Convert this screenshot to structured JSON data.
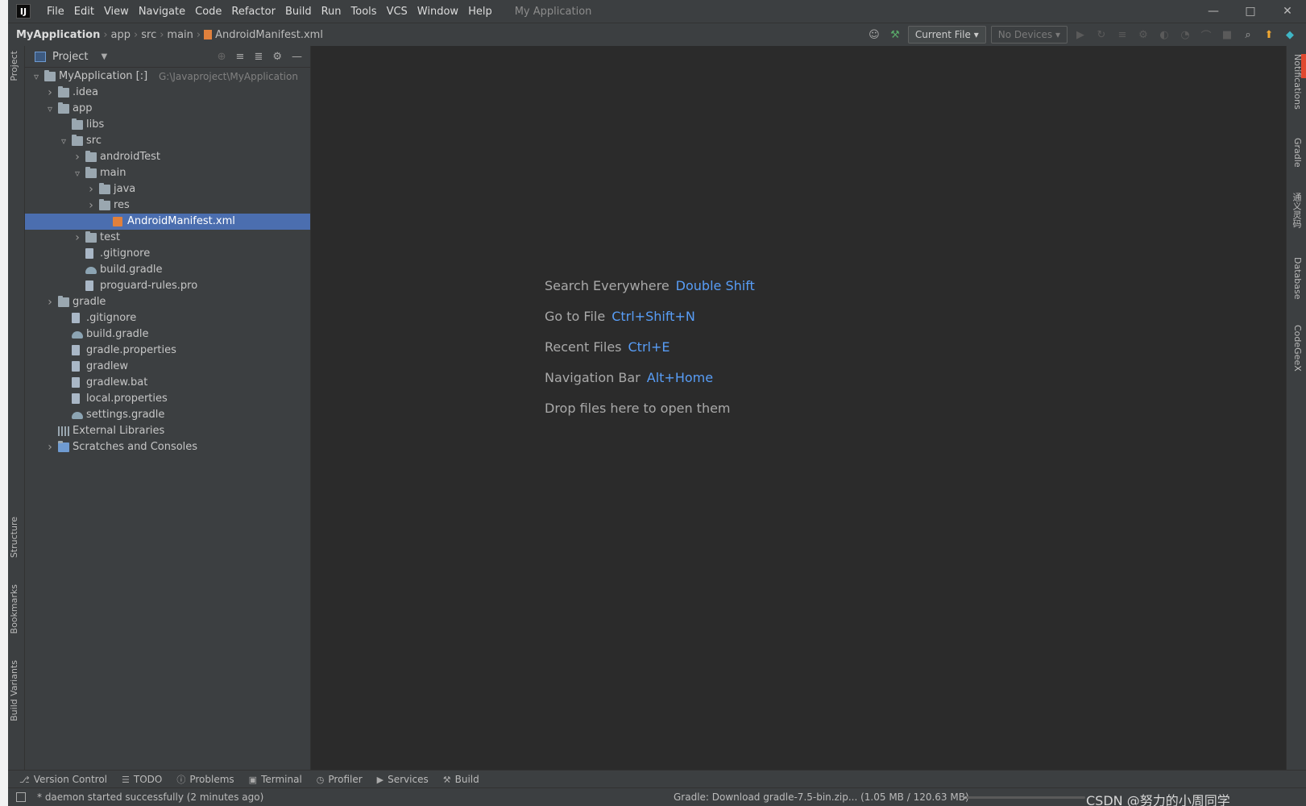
{
  "titlebar": {
    "menu": [
      "File",
      "Edit",
      "View",
      "Navigate",
      "Code",
      "Refactor",
      "Build",
      "Run",
      "Tools",
      "VCS",
      "Window",
      "Help"
    ],
    "app_title": "My Application"
  },
  "breadcrumb": [
    "MyApplication",
    "app",
    "src",
    "main",
    "AndroidManifest.xml"
  ],
  "toolbar": {
    "run_config": "Current File",
    "device": "No Devices"
  },
  "left_tabs": {
    "project": "Project",
    "structure": "Structure",
    "bookmarks": "Bookmarks",
    "build_variants": "Build Variants"
  },
  "right_tabs": {
    "notifications": "Notifications",
    "gradle": "Gradle",
    "translate": "通义灵码",
    "database": "Database",
    "codegeex": "CodeGeeX"
  },
  "project_panel": {
    "title": "Project",
    "tree": [
      {
        "label": "MyApplication [:]",
        "path": "G:\\Javaproject\\MyApplication",
        "depth": 0,
        "arrow": "open",
        "icon": "module"
      },
      {
        "label": ".idea",
        "depth": 1,
        "arrow": "closed",
        "icon": "folder"
      },
      {
        "label": "app",
        "depth": 1,
        "arrow": "open",
        "icon": "folder"
      },
      {
        "label": "libs",
        "depth": 2,
        "arrow": "none",
        "icon": "folder"
      },
      {
        "label": "src",
        "depth": 2,
        "arrow": "open",
        "icon": "folder"
      },
      {
        "label": "androidTest",
        "depth": 3,
        "arrow": "closed",
        "icon": "folder"
      },
      {
        "label": "main",
        "depth": 3,
        "arrow": "open",
        "icon": "folder"
      },
      {
        "label": "java",
        "depth": 4,
        "arrow": "closed",
        "icon": "folder"
      },
      {
        "label": "res",
        "depth": 4,
        "arrow": "closed",
        "icon": "folder"
      },
      {
        "label": "AndroidManifest.xml",
        "depth": 5,
        "arrow": "none",
        "icon": "xml",
        "selected": true
      },
      {
        "label": "test",
        "depth": 3,
        "arrow": "closed",
        "icon": "folder"
      },
      {
        "label": ".gitignore",
        "depth": 3,
        "arrow": "none",
        "icon": "file"
      },
      {
        "label": "build.gradle",
        "depth": 3,
        "arrow": "none",
        "icon": "gradle"
      },
      {
        "label": "proguard-rules.pro",
        "depth": 3,
        "arrow": "none",
        "icon": "file"
      },
      {
        "label": "gradle",
        "depth": 1,
        "arrow": "closed",
        "icon": "folder"
      },
      {
        "label": ".gitignore",
        "depth": 2,
        "arrow": "none",
        "icon": "file"
      },
      {
        "label": "build.gradle",
        "depth": 2,
        "arrow": "none",
        "icon": "gradle"
      },
      {
        "label": "gradle.properties",
        "depth": 2,
        "arrow": "none",
        "icon": "file"
      },
      {
        "label": "gradlew",
        "depth": 2,
        "arrow": "none",
        "icon": "file"
      },
      {
        "label": "gradlew.bat",
        "depth": 2,
        "arrow": "none",
        "icon": "file"
      },
      {
        "label": "local.properties",
        "depth": 2,
        "arrow": "none",
        "icon": "file"
      },
      {
        "label": "settings.gradle",
        "depth": 2,
        "arrow": "none",
        "icon": "gradle"
      },
      {
        "label": "External Libraries",
        "depth": 1,
        "arrow": "none",
        "icon": "library"
      },
      {
        "label": "Scratches and Consoles",
        "depth": 1,
        "arrow": "closed",
        "icon": "scratch"
      }
    ]
  },
  "editor_hints": [
    {
      "text": "Search Everywhere",
      "key": "Double Shift"
    },
    {
      "text": "Go to File",
      "key": "Ctrl+Shift+N"
    },
    {
      "text": "Recent Files",
      "key": "Ctrl+E"
    },
    {
      "text": "Navigation Bar",
      "key": "Alt+Home"
    },
    {
      "text": "Drop files here to open them",
      "key": ""
    }
  ],
  "bottom_tabs": [
    "Version Control",
    "TODO",
    "Problems",
    "Terminal",
    "Profiler",
    "Services",
    "Build"
  ],
  "status": {
    "message": "* daemon started successfully (2 minutes ago)",
    "gradle": "Gradle: Download gradle-7.5-bin.zip...  (1.05 MB / 120.63 MB)",
    "progress": 0.009,
    "watermark": "CSDN @努力的小周同学"
  },
  "colors": {
    "selection": "#4b6eaf",
    "hint_key": "#589df6",
    "panel_bg": "#3c3f41",
    "editor_bg": "#2b2b2b"
  }
}
